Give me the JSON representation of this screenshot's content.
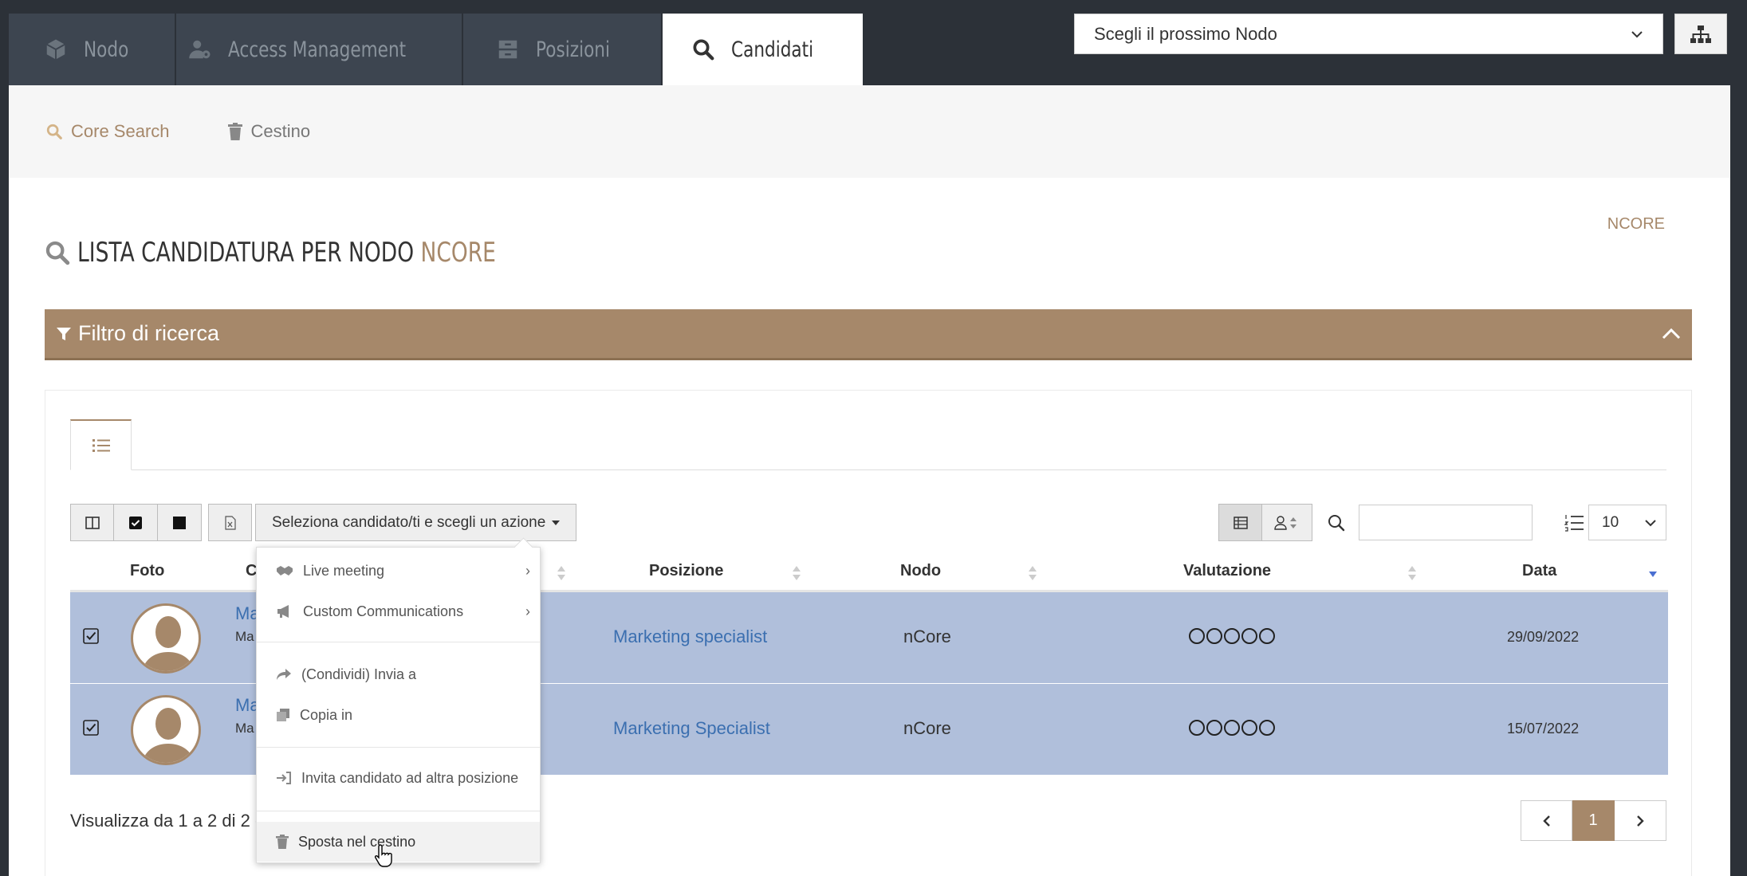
{
  "tabs": [
    {
      "label": "Nodo",
      "icon": "cube-icon"
    },
    {
      "label": "Access Management",
      "icon": "user-gear-icon"
    },
    {
      "label": "Posizioni",
      "icon": "archive-icon"
    },
    {
      "label": "Candidati",
      "icon": "search-icon",
      "active": true
    }
  ],
  "node_select": {
    "value": "Scegli il prossimo Nodo"
  },
  "subnav": {
    "core_search": "Core Search",
    "cestino": "Cestino"
  },
  "top_link": "NCORE",
  "page_title": {
    "text": "LISTA CANDIDATURA PER NODO",
    "accent": "NCORE"
  },
  "filter": {
    "title": "Filtro di ricerca"
  },
  "toolbar": {
    "action_label": "Seleziona candidato/ti e scegli un azione"
  },
  "per_page": "10",
  "table": {
    "headers": [
      "Foto",
      "C",
      "Posizione",
      "Nodo",
      "Valutazione",
      "Data"
    ],
    "rows": [
      {
        "name": "Ma",
        "sub": "Ma",
        "position": "Marketing specialist",
        "node": "nCore",
        "date": "29/09/2022"
      },
      {
        "name": "Ma",
        "sub": "Ma",
        "position": "Marketing Specialist",
        "node": "nCore",
        "date": "15/07/2022"
      }
    ]
  },
  "info": "Visualizza da 1 a 2 di 2 e",
  "pager": {
    "current": "1"
  },
  "menu": {
    "items": [
      "Live meeting",
      "Custom Communications",
      "(Condividi) Invia a",
      "Copia in",
      "Invita candidato ad altra posizione",
      "Sposta nel cestino"
    ]
  },
  "colors": {
    "accent": "#a6886a",
    "selected_row": "#b0bfdb",
    "link": "#3b6fb0",
    "dark_bg": "#2c3138"
  }
}
